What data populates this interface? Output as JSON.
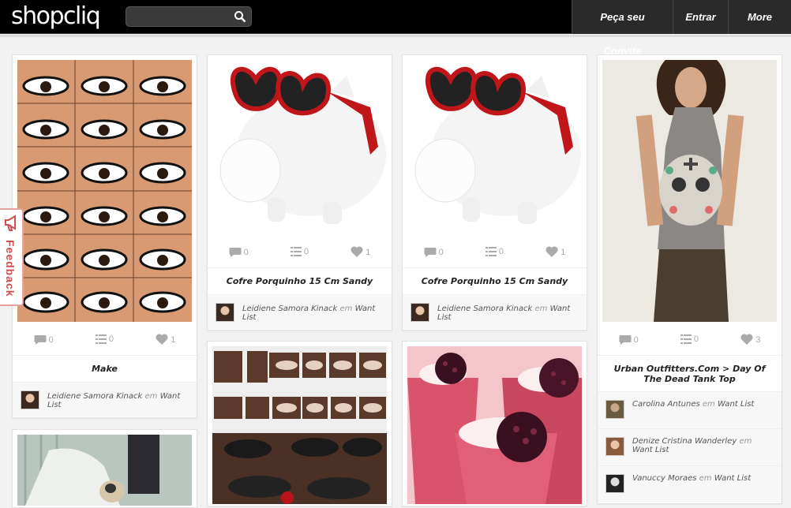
{
  "header": {
    "logo": "shopcliq",
    "search_placeholder": "",
    "nav": [
      "Peça seu Convite",
      "Entrar",
      "More"
    ]
  },
  "feedback": {
    "label": "Feedback"
  },
  "cards": [
    {
      "stats": {
        "comments": "0",
        "lists": "0",
        "likes": "1"
      },
      "title": "Make",
      "by": {
        "user": "Leidiene Samora Kinack",
        "em": "em",
        "list": "Want List"
      }
    },
    {
      "stats": {
        "comments": "0",
        "lists": "0",
        "likes": "1"
      },
      "title": "Cofre Porquinho 15 Cm Sandy",
      "by": {
        "user": "Leidiene Samora Kinack",
        "em": "em",
        "list": "Want List"
      }
    },
    {
      "stats": {
        "comments": "0",
        "lists": "0",
        "likes": "1"
      },
      "title": "Cofre Porquinho 15 Cm Sandy",
      "by": {
        "user": "Leidiene Samora Kinack",
        "em": "em",
        "list": "Want List"
      }
    },
    {
      "stats": {
        "comments": "0",
        "lists": "0",
        "likes": "3"
      },
      "title": "Urban Outfitters.Com > Day Of The Dead Tank Top",
      "by_list": [
        {
          "user": "Carolina Antunes",
          "em": "em",
          "list": "Want List"
        },
        {
          "user": "Denize Cristina Wanderley",
          "em": "em",
          "list": "Want List"
        },
        {
          "user": "Vanuccy Moraes",
          "em": "em",
          "list": "Want List"
        }
      ]
    }
  ],
  "colors": {
    "header_bg": "#000000",
    "nav_bg": "#2a2a2a",
    "feedback": "#d05050",
    "page_bg": "#f2f2f2"
  }
}
